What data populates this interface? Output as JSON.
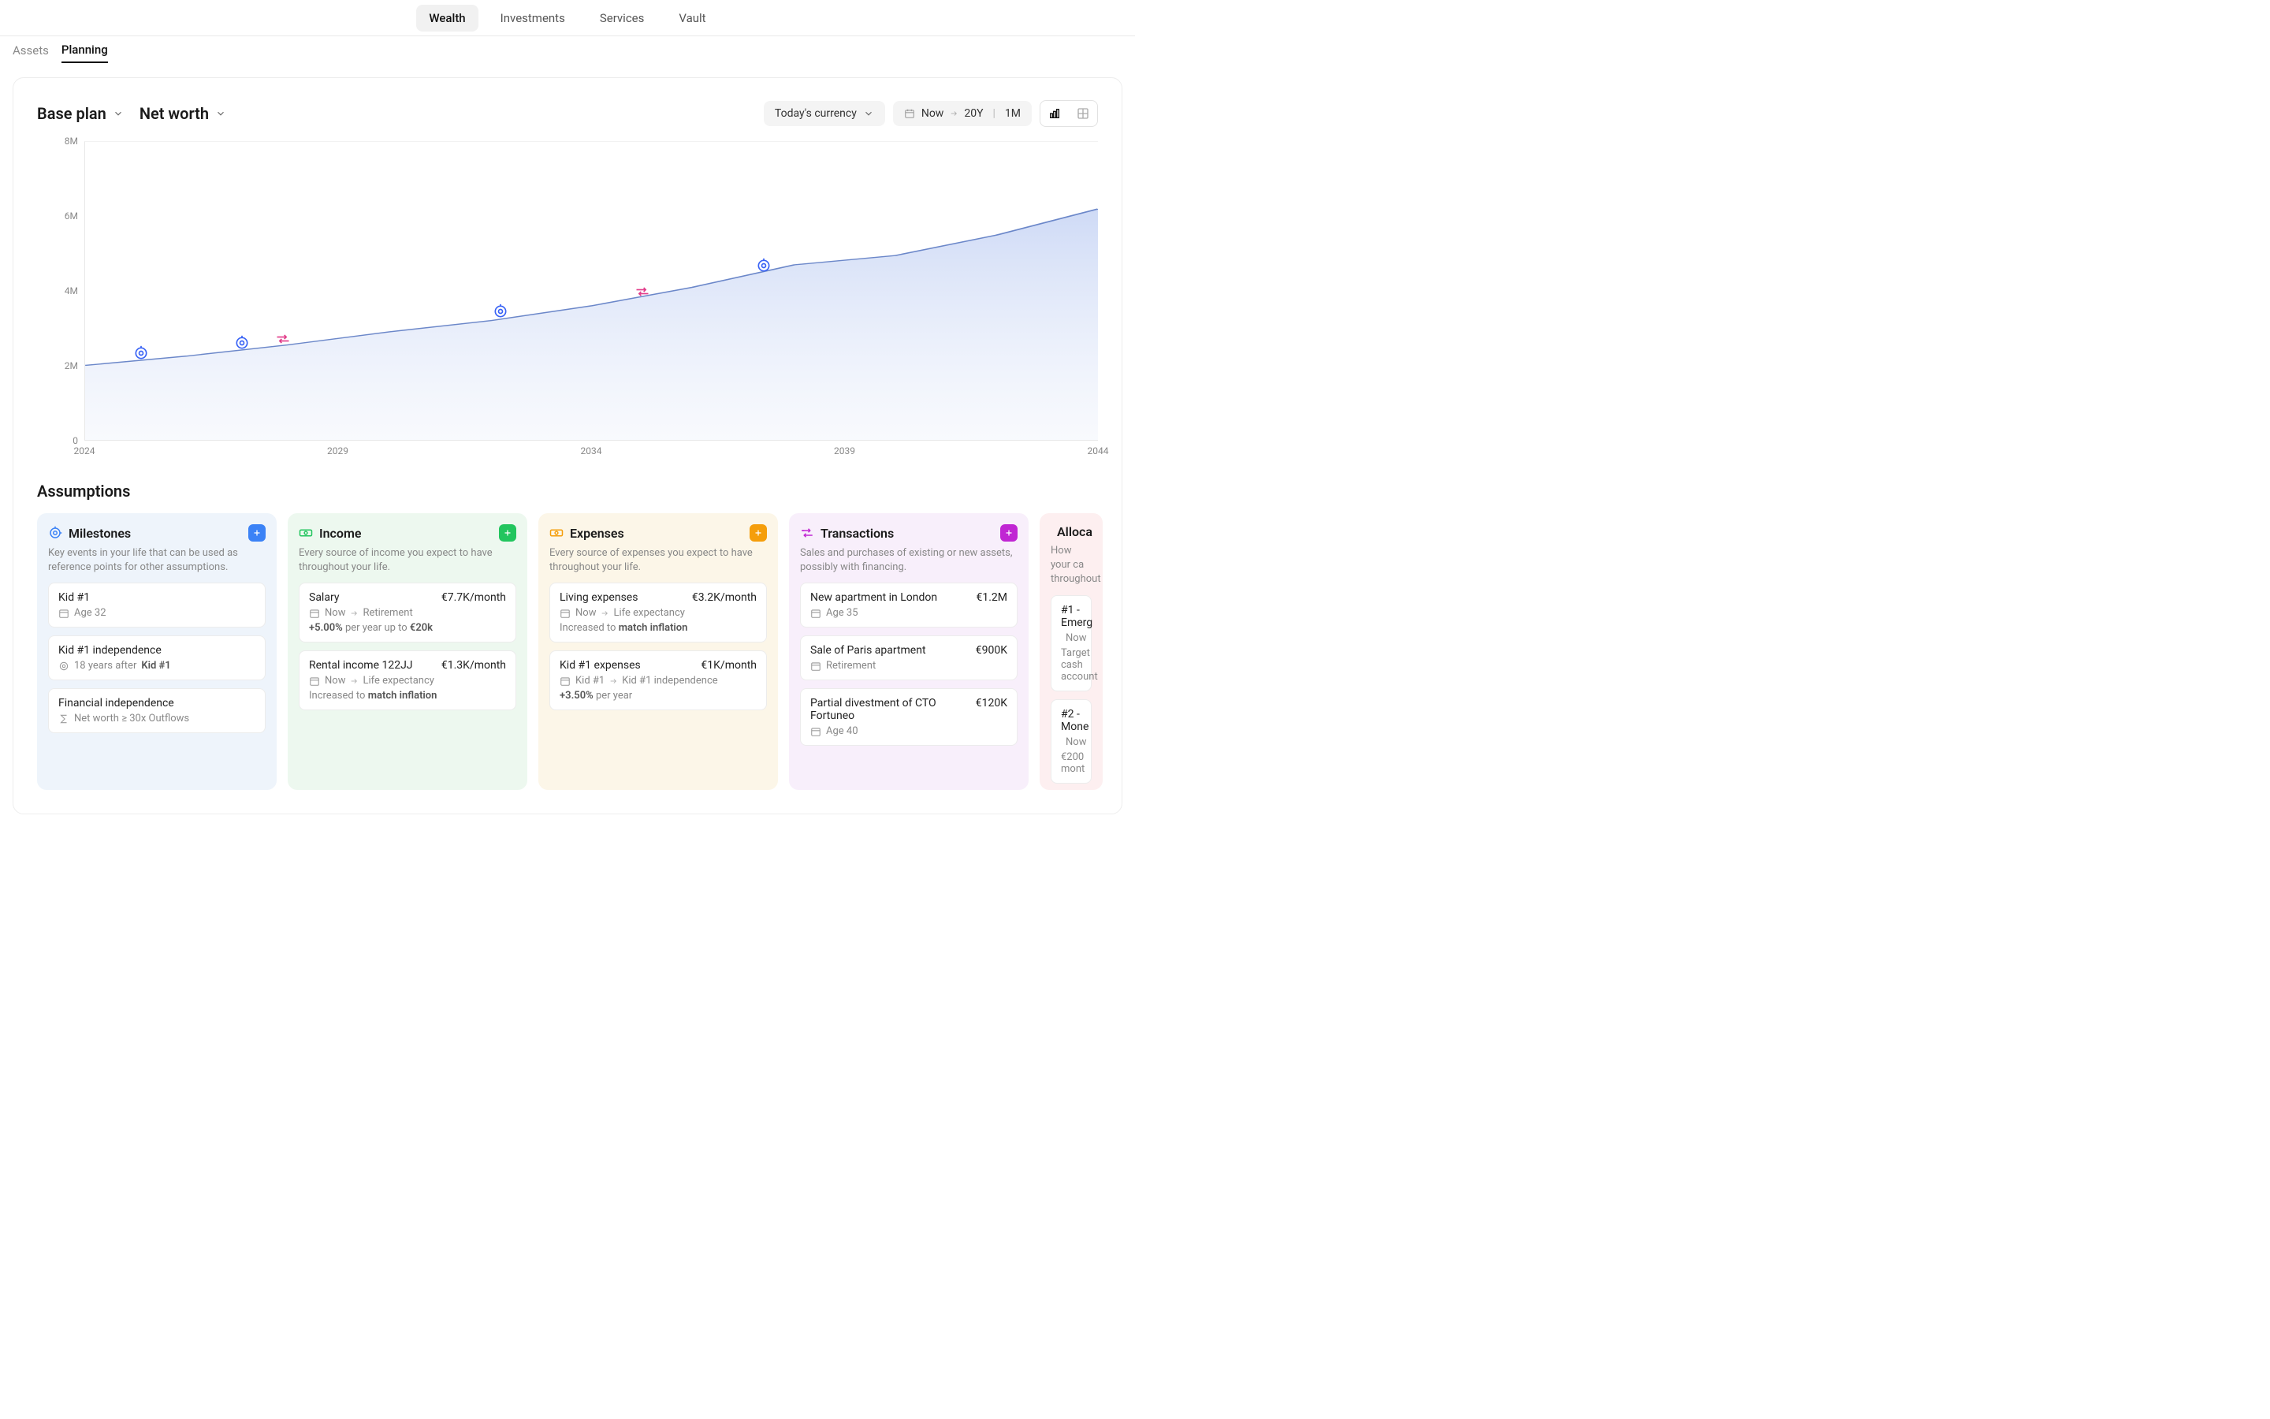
{
  "topnav": {
    "items": [
      "Wealth",
      "Investments",
      "Services",
      "Vault"
    ],
    "active": 0
  },
  "subnav": {
    "items": [
      "Assets",
      "Planning"
    ],
    "active": 1
  },
  "controls": {
    "plan_label": "Base plan",
    "metric_label": "Net worth",
    "currency_label": "Today's currency",
    "range_from": "Now",
    "range_to": "20Y",
    "range_gran": "1M"
  },
  "chart_data": {
    "type": "area",
    "ylabel": "",
    "xlabel": "",
    "ylim": [
      0,
      8000000
    ],
    "x_ticks": [
      "2024",
      "2029",
      "2034",
      "2044",
      "2039"
    ],
    "y_ticks": [
      "0",
      "2M",
      "4M",
      "6M",
      "8M"
    ],
    "x": [
      2024,
      2026,
      2028,
      2030,
      2032,
      2034,
      2036,
      2038,
      2040,
      2042,
      2044
    ],
    "values": [
      2000000,
      2250000,
      2550000,
      2900000,
      3200000,
      3600000,
      4100000,
      4700000,
      4950000,
      5500000,
      6200000
    ],
    "markers": [
      {
        "type": "milestone",
        "x": 2025.1,
        "y": 2320000
      },
      {
        "type": "milestone",
        "x": 2027.1,
        "y": 2600000
      },
      {
        "type": "transaction",
        "x": 2027.9,
        "y": 2700000
      },
      {
        "type": "milestone",
        "x": 2032.2,
        "y": 3450000
      },
      {
        "type": "transaction",
        "x": 2035.0,
        "y": 3980000
      },
      {
        "type": "milestone",
        "x": 2037.4,
        "y": 4680000
      }
    ]
  },
  "assumptions": {
    "title": "Assumptions",
    "categories": [
      {
        "key": "milestones",
        "title": "Milestones",
        "desc": "Key events in your life that can be used as reference points for other assumptions.",
        "items": [
          {
            "name": "Kid #1",
            "meta_icon": "calendar",
            "meta": "Age 32"
          },
          {
            "name": "Kid #1 independence",
            "meta_icon": "target",
            "meta_prefix": "18 years after ",
            "meta_bold": "Kid #1"
          },
          {
            "name": "Financial independence",
            "meta_icon": "sigma",
            "meta": "Net worth ≥ 30x Outflows"
          }
        ]
      },
      {
        "key": "income",
        "title": "Income",
        "desc": "Every source of income you expect to have throughout your life.",
        "items": [
          {
            "name": "Salary",
            "value": "€7.7K/month",
            "from": "Now",
            "to": "Retirement",
            "extra_prefix": "+5.00% ",
            "extra_mid": "per year up to ",
            "extra_bold": "€20k"
          },
          {
            "name": "Rental income 122JJ",
            "value": "€1.3K/month",
            "from": "Now",
            "to": "Life expectancy",
            "extra_prefix": "Increased to ",
            "extra_bold": "match inflation"
          }
        ]
      },
      {
        "key": "expenses",
        "title": "Expenses",
        "desc": "Every source of expenses you expect to have throughout your life.",
        "items": [
          {
            "name": "Living expenses",
            "value": "€3.2K/month",
            "from": "Now",
            "to": "Life expectancy",
            "extra_prefix": "Increased to ",
            "extra_bold": "match inflation"
          },
          {
            "name": "Kid #1 expenses",
            "value": "€1K/month",
            "from": "Kid #1",
            "to": "Kid #1 independence",
            "extra_prefix": "+3.50% ",
            "extra_mid": "per year"
          }
        ]
      },
      {
        "key": "transactions",
        "title": "Transactions",
        "desc": "Sales and purchases of existing or new assets, possibly with financing.",
        "items": [
          {
            "name": "New apartment in London",
            "value": "€1.2M",
            "meta": "Age 35"
          },
          {
            "name": "Sale of Paris apartment",
            "value": "€900K",
            "meta": "Retirement"
          },
          {
            "name": "Partial divestment of CTO Fortuneo",
            "value": "€120K",
            "meta": "Age 40"
          }
        ]
      },
      {
        "key": "allocations",
        "title": "Alloca",
        "desc": "How your ca throughout",
        "items": [
          {
            "name": "#1 - Emerg",
            "from": "Now",
            "extra": "Target cash account"
          },
          {
            "name": "#2 - Mone",
            "from": "Now",
            "extra": "€200 mont"
          }
        ]
      }
    ]
  }
}
